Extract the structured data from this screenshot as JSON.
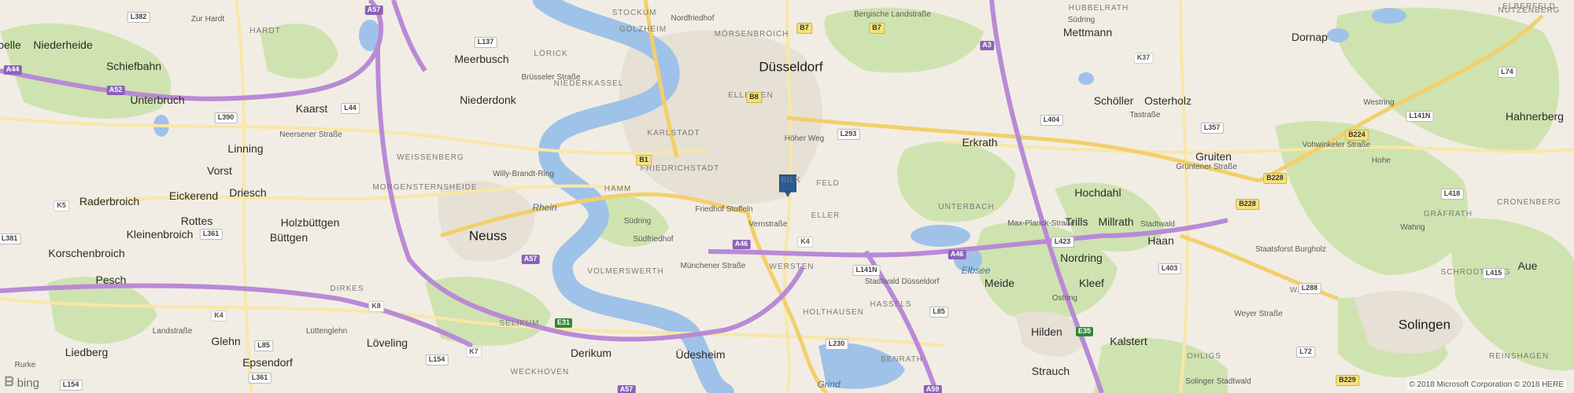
{
  "map": {
    "colors": {
      "land": "#f1ede4",
      "forest": "#cfe3b0",
      "urban": "#e6e0d5",
      "water": "#9fc2e8",
      "motorway": "#b98ad6",
      "primary": "#f3cf6b",
      "secondary": "#f8e7a8",
      "pin": "#2d5a93"
    },
    "cities": [
      "Düsseldorf",
      "Neuss",
      "Solingen",
      "Hilden",
      "Meerbusch",
      "Mettmann",
      "Erkrath",
      "Haan",
      "Dornap",
      "Kaarst",
      "Niederdonk",
      "Niederheide",
      "Schiefbahn",
      "Unterbruch",
      "Linning",
      "Vorst",
      "Eickerend",
      "Driesch",
      "Raderbroich",
      "Rottes",
      "Kleinenbroich",
      "Holzbüttgen",
      "Büttgen",
      "Korschenbroich",
      "Pesch",
      "Glehn",
      "Liedberg",
      "Epsendorf",
      "Löveling",
      "Derikum",
      "Üdesheim",
      "Hochdahl",
      "Trills",
      "Millrath",
      "Nordring",
      "Kleef",
      "Meide",
      "Gruiten",
      "Schöller",
      "Osterholz",
      "Hahnerberg",
      "Aue",
      "Kalstert",
      "Strauch",
      "pelle"
    ],
    "districts": [
      "STOCKUM",
      "GOLZHEIM",
      "LÖRICK",
      "NIEDERKASSEL",
      "KARLSTADT",
      "FRIEDRICHSTADT",
      "HAMM",
      "WEISSENBERG",
      "MORGENSTERNSHEIDE",
      "VOLMERSWERTH",
      "ELLER",
      "UNTERBACH",
      "WERSTEN",
      "HOLTHAUSEN",
      "HASSELS",
      "BENRATH",
      "SELIKUM",
      "WECKHOVEN",
      "DIRKES",
      "GRÄFRATH",
      "CRONENBERG",
      "WALD",
      "OHLIGS",
      "HUBBELRATH",
      "HARDT",
      "NÜTZENBERG",
      "ELBERFELD",
      "REINSHAGEN",
      "SCHRODTBERG",
      "MÖRSENBROICH",
      "ELLINGEN",
      "BILK",
      "FELD"
    ],
    "water_labels": [
      "Rhein",
      "Elbsee",
      "Grind"
    ],
    "streets": [
      "Brüsseler Straße",
      "Neersener Straße",
      "Willy-Brandt-Ring",
      "Südring",
      "Münchener Straße",
      "Höher Weg",
      "Grüntener Straße",
      "Max-Planck-Straße",
      "Ostring",
      "Weyer Straße",
      "Vohwinkeler Straße",
      "Westring",
      "Landstraße",
      "Lüttenglehn",
      "Zur Hardt",
      "Bergische Landstraße",
      "Südring",
      "Tastraße",
      "Friedhof Stoffeln",
      "Südfriedhof",
      "Nordfriedhof",
      "Stadtwald Düsseldorf",
      "Staatsforst Burgholz",
      "Stadtwald",
      "Solinger Stadtwald",
      "Wahrig",
      "Hohe",
      "Rurke",
      "Vernstraße"
    ],
    "shields": {
      "motorway": [
        "A44",
        "A52",
        "A57",
        "A3",
        "A46",
        "A46",
        "A57",
        "A59",
        "A57"
      ],
      "european": [
        "E31",
        "E35"
      ],
      "federal": [
        "B7",
        "B8",
        "B1",
        "B224",
        "B228",
        "B229",
        "B7",
        "B228"
      ],
      "state": [
        "L382",
        "L137",
        "L44",
        "L390",
        "L381",
        "L361",
        "L154",
        "L361",
        "L154",
        "L230",
        "L293",
        "L404",
        "L357",
        "L423",
        "L403",
        "L288",
        "L141N",
        "L418",
        "L415",
        "L74",
        "L72",
        "L141N",
        "L85",
        "L85",
        "L361"
      ],
      "county": [
        "K5",
        "K8",
        "K4",
        "K7",
        "K37",
        "K4"
      ]
    },
    "attribution": {
      "logo": "bing",
      "copyright": "© 2018 Microsoft Corporation © 2018 HERE"
    }
  }
}
